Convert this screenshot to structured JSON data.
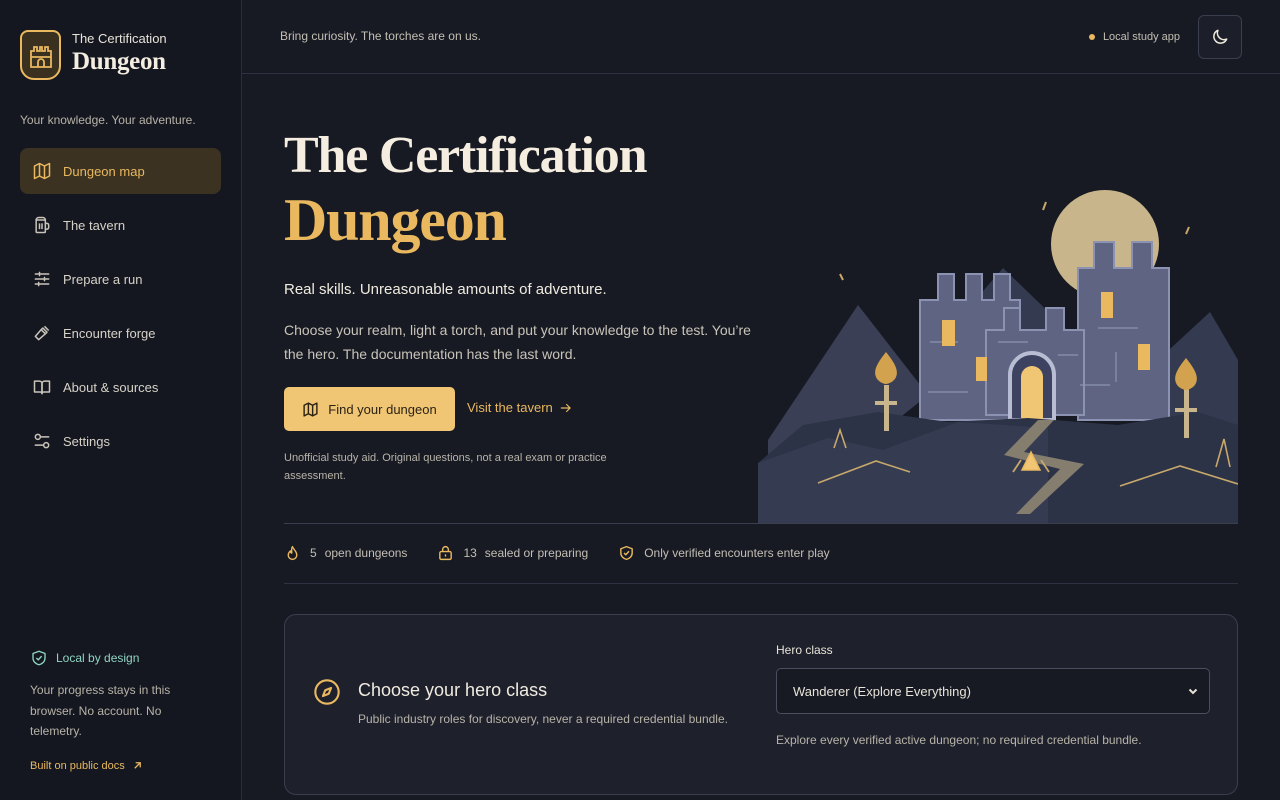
{
  "brand": {
    "small": "The Certification",
    "big": "Dungeon",
    "tagline": "Your knowledge. Your adventure."
  },
  "nav": {
    "items": [
      {
        "label": "Dungeon map",
        "icon": "map-icon",
        "active": true
      },
      {
        "label": "The tavern",
        "icon": "mug-icon",
        "active": false
      },
      {
        "label": "Prepare a run",
        "icon": "sliders-icon",
        "active": false
      },
      {
        "label": "Encounter forge",
        "icon": "hammer-icon",
        "active": false
      },
      {
        "label": "About & sources",
        "icon": "book-icon",
        "active": false
      },
      {
        "label": "Settings",
        "icon": "settings-icon",
        "active": false
      }
    ]
  },
  "sidebar_footer": {
    "title": "Local by design",
    "desc": "Your progress stays in this browser. No account. No telemetry.",
    "link": "Built on public docs"
  },
  "topbar": {
    "motto": "Bring curiosity. The torches are on us.",
    "status": "Local study app",
    "theme_icon": "moon-icon"
  },
  "hero": {
    "title_line1": "The Certification",
    "title_line2": "Dungeon",
    "subtitle": "Real skills. Unreasonable amounts of adventure.",
    "description": "Choose your realm, light a torch, and put your knowledge to the test. You’re the hero. The documentation has the last word.",
    "primary_button": "Find your dungeon",
    "secondary_link": "Visit the tavern",
    "disclaimer": "Unofficial study aid. Original questions, not a real exam or practice assessment."
  },
  "stats": [
    {
      "count": "5",
      "label": "open dungeons",
      "icon": "flame-icon"
    },
    {
      "count": "13",
      "label": "sealed or preparing",
      "icon": "lock-icon"
    },
    {
      "count": "",
      "label": "Only verified encounters enter play",
      "icon": "shield-check-icon"
    }
  ],
  "hero_class": {
    "title": "Choose your hero class",
    "desc": "Public industry roles for discovery, never a required credential bundle.",
    "field_label": "Hero class",
    "selected": "Wanderer (Explore Everything)",
    "help": "Explore every verified active dungeon; no required credential bundle."
  },
  "colors": {
    "accent": "#e9b85f",
    "background": "#171a23",
    "sidebar": "#141720",
    "teal": "#8fd4c3"
  }
}
